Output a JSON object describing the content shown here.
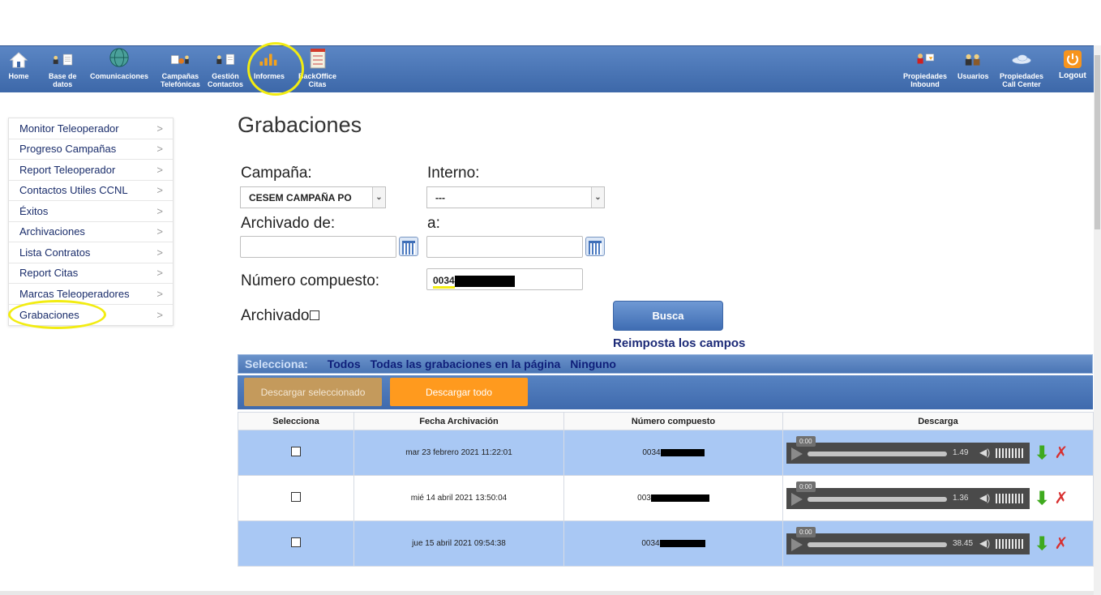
{
  "nav": {
    "left": [
      {
        "id": "home",
        "label": "Home"
      },
      {
        "id": "db",
        "label": "Base de\ndatos"
      },
      {
        "id": "comm",
        "label": "Comunicaciones"
      },
      {
        "id": "camp",
        "label": "Campañas\nTelefónicas"
      },
      {
        "id": "gest",
        "label": "Gestión\nContactos"
      },
      {
        "id": "inf",
        "label": "Informes"
      },
      {
        "id": "back",
        "label": "BackOffice\nCitas"
      }
    ],
    "right": [
      {
        "id": "pinb",
        "label": "Propiedades\nInbound"
      },
      {
        "id": "usr",
        "label": "Usuarios"
      },
      {
        "id": "pcc",
        "label": "Propiedades\nCall Center"
      },
      {
        "id": "logout",
        "label": "Logout"
      }
    ]
  },
  "sidebar": {
    "items": [
      {
        "label": "Monitor Teleoperador"
      },
      {
        "label": "Progreso Campañas"
      },
      {
        "label": "Report Teleoperador"
      },
      {
        "label": "Contactos Utiles CCNL"
      },
      {
        "label": "Éxitos"
      },
      {
        "label": "Archivaciones"
      },
      {
        "label": "Lista Contratos"
      },
      {
        "label": "Report Citas"
      },
      {
        "label": "Marcas Teleoperadores"
      },
      {
        "label": "Grabaciones"
      }
    ],
    "chevron": ">"
  },
  "page": {
    "title": "Grabaciones"
  },
  "form": {
    "campana_label": "Campaña:",
    "campana_value": "CESEM CAMPAÑA PO",
    "interno_label": "Interno:",
    "interno_value": "---",
    "archivado_de_label": "Archivado de:",
    "a_label": "a:",
    "numero_label": "Número compuesto:",
    "numero_value": "0034",
    "archivado_label": "Archivado",
    "busca_label": "Busca",
    "reimposta_label": "Reimposta los campos"
  },
  "select_bar": {
    "label": "Selecciona:",
    "todos": "Todos",
    "todas": "Todas las grabaciones en la página",
    "ninguno": "Ninguno"
  },
  "download_bar": {
    "selected_label": "Descargar seleccionado",
    "all_label": "Descargar todo"
  },
  "table": {
    "headers": [
      "Selecciona",
      "Fecha Archivación",
      "Número compuesto",
      "Descarga"
    ],
    "rows": [
      {
        "fecha": "mar 23 febrero 2021 11:22:01",
        "numero": "0034",
        "time": "0:00",
        "duration": "1.49"
      },
      {
        "fecha": "mié 14 abril 2021 13:50:04",
        "numero": "003",
        "time": "0:00",
        "duration": "1.36"
      },
      {
        "fecha": "jue 15 abril 2021 09:54:38",
        "numero": "0034",
        "time": "0:00",
        "duration": "38.45"
      }
    ]
  },
  "colors": {
    "nav": "#4a76b7",
    "accent_circle": "#f2ec11",
    "link": "#1c2a77",
    "orange": "#ff9a1e",
    "row_blue": "#a9c8f4"
  }
}
